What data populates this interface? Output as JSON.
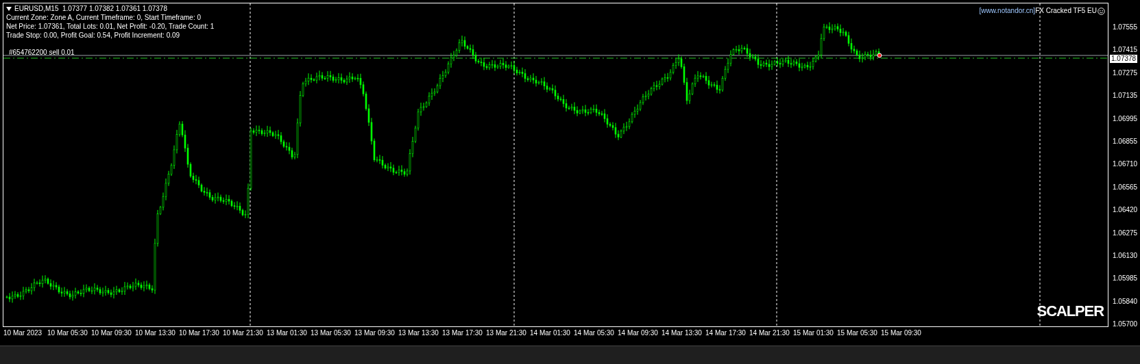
{
  "chart": {
    "symbol_line": "EURUSD,M15  1.07377 1.07382 1.07361 1.07378",
    "info_lines": [
      "Current Zone: Zone A, Current Timeframe: 0, Start Timeframe: 0",
      "Net Price: 1.07361, Total Lots: 0.01, Net Profit: -0.20, Trade Count: 1",
      "Trade Stop: 0.00, Profit Goal: 0.54, Profit Increment: 0.09"
    ],
    "order_label": "#654762200 sell 0.01",
    "expert_link": "[www.notandor.cn]",
    "expert_name": "FX Cracked TF5 EU",
    "scalper_label": "SCALPER"
  },
  "price_axis": {
    "ticks": [
      "1.07555",
      "1.07415",
      "1.07275",
      "1.07135",
      "1.06995",
      "1.06855",
      "1.06710",
      "1.06565",
      "1.06420",
      "1.06275",
      "1.06130",
      "1.05985",
      "1.05840",
      "1.05700"
    ],
    "current_price": "1.07378"
  },
  "time_axis": {
    "labels": [
      "10 Mar 2023",
      "10 Mar 05:30",
      "10 Mar 09:30",
      "10 Mar 13:30",
      "10 Mar 17:30",
      "10 Mar 21:30",
      "13 Mar 01:30",
      "13 Mar 05:30",
      "13 Mar 09:30",
      "13 Mar 13:30",
      "13 Mar 17:30",
      "13 Mar 21:30",
      "14 Mar 01:30",
      "14 Mar 05:30",
      "14 Mar 09:30",
      "14 Mar 13:30",
      "14 Mar 17:30",
      "14 Mar 21:30",
      "15 Mar 01:30",
      "15 Mar 05:30",
      "15 Mar 09:30"
    ]
  }
}
